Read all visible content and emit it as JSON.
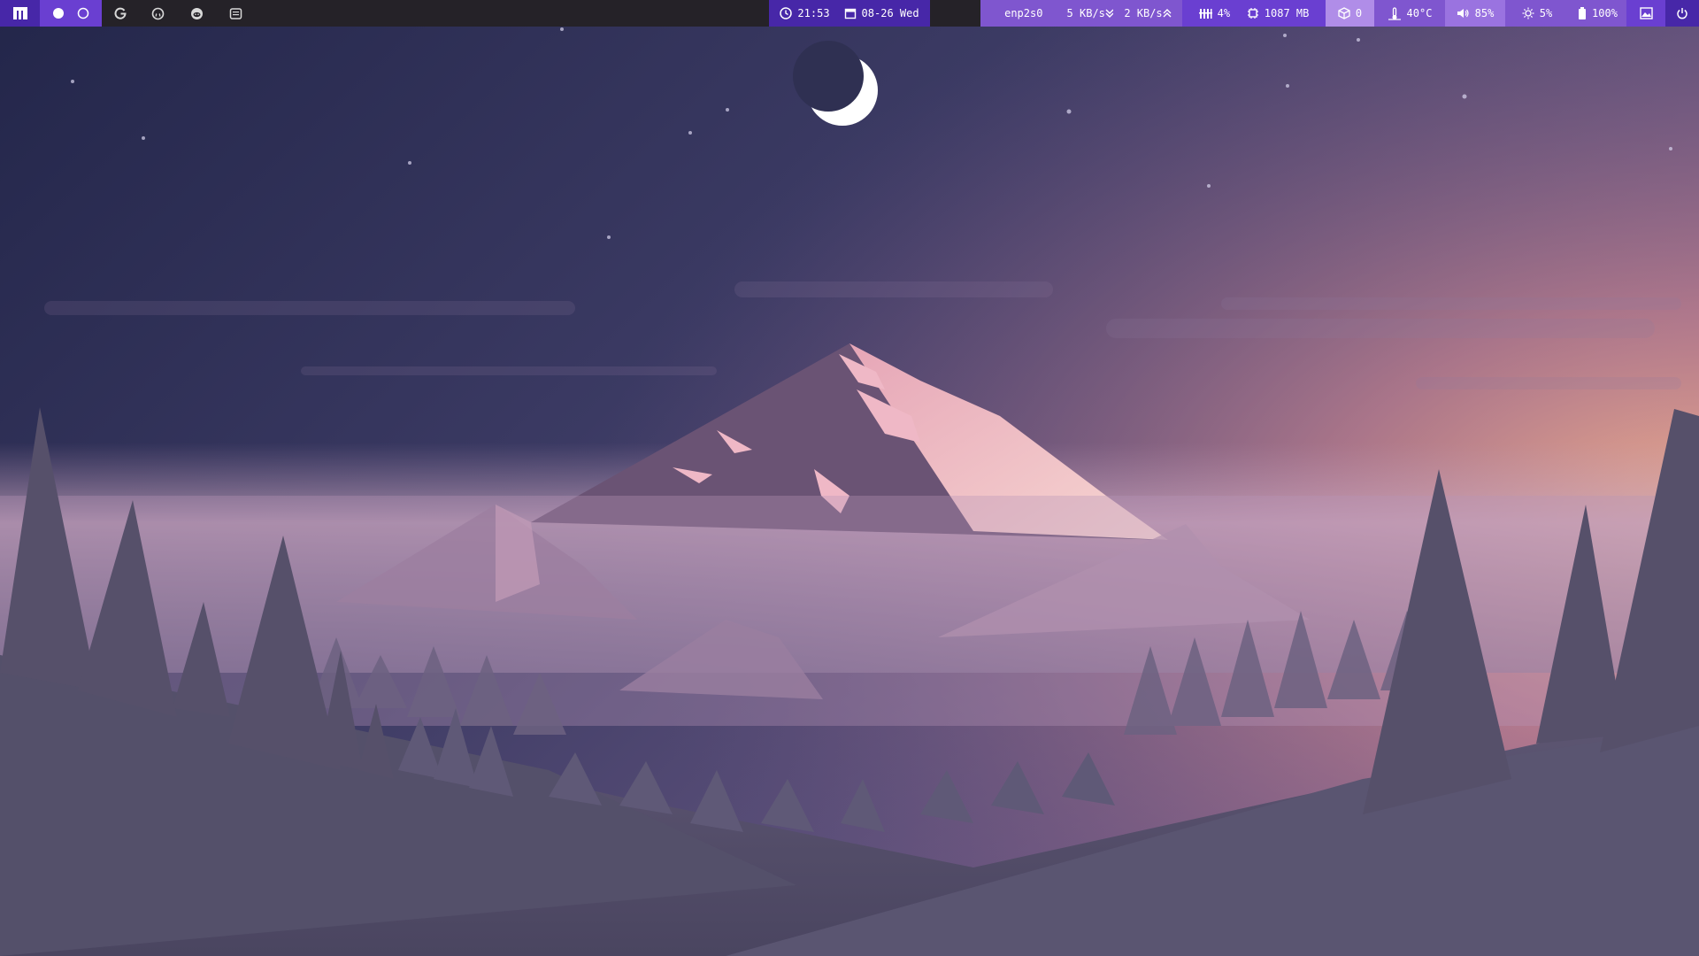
{
  "colors": {
    "bar_bg": "#252228",
    "accent_dark": "#4727a8",
    "accent": "#6a3fd1",
    "accent_light": "#7f56cf",
    "accent_lighter": "#9a73e0",
    "accent_pale": "#b08de8"
  },
  "workspaces": {
    "icons": [
      "filled-circle",
      "hollow-circle"
    ]
  },
  "launchers": [
    {
      "name": "google",
      "icon": "google-icon"
    },
    {
      "name": "github",
      "icon": "github-icon"
    },
    {
      "name": "reddit",
      "icon": "reddit-icon"
    },
    {
      "name": "youtube",
      "icon": "youtube-icon"
    }
  ],
  "clock": {
    "time": "21:53",
    "date": "08-26 Wed"
  },
  "network": {
    "interface": "enp2s0",
    "down": "5 KB/s",
    "up": "2 KB/s"
  },
  "stats": {
    "cpu": "4%",
    "memory": "1087 MB",
    "updates": "0",
    "temperature": "40°C",
    "volume": "85%",
    "brightness": "5%",
    "battery": "100%"
  }
}
